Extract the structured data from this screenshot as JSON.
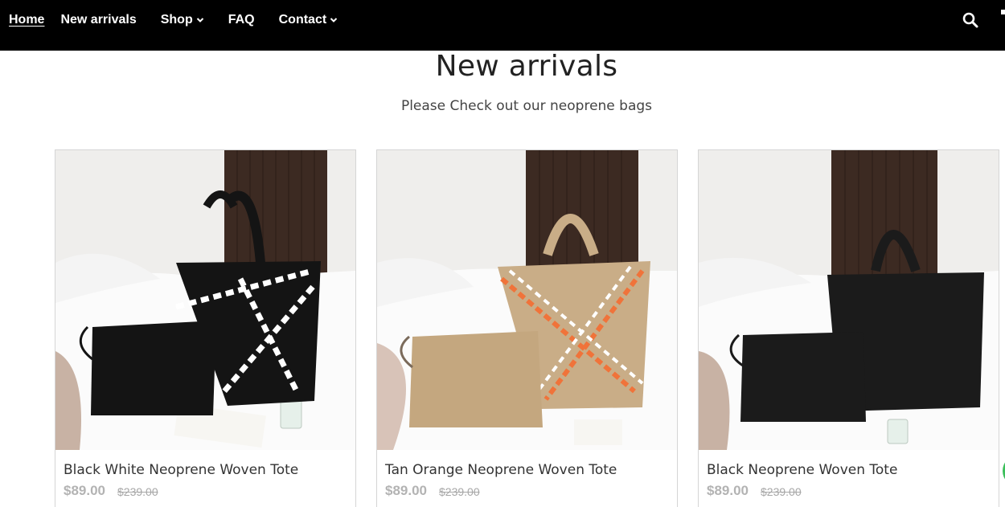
{
  "nav": {
    "items": [
      {
        "label": "Home",
        "dropdown": false,
        "active": true
      },
      {
        "label": "New arrivals",
        "dropdown": false,
        "active": false
      },
      {
        "label": "Shop",
        "dropdown": true,
        "active": false
      },
      {
        "label": "FAQ",
        "dropdown": false,
        "active": false
      },
      {
        "label": "Contact",
        "dropdown": true,
        "active": false
      }
    ],
    "search_icon": "search-icon"
  },
  "section": {
    "title": "New arrivals",
    "subtitle": "Please Check out our neoprene bags"
  },
  "products": [
    {
      "title": "Black White Neoprene Woven Tote",
      "price": "$89.00",
      "old_price": "$239.00",
      "bag_color": "#141414",
      "accent_colors": [
        "#ffffff"
      ]
    },
    {
      "title": "Tan Orange Neoprene Woven Tote",
      "price": "$89.00",
      "old_price": "$239.00",
      "bag_color": "#c9ad87",
      "accent_colors": [
        "#f0733a",
        "#ffffff"
      ]
    },
    {
      "title": "Black Neoprene Woven Tote",
      "price": "$89.00",
      "old_price": "$239.00",
      "bag_color": "#1b1b1b",
      "accent_colors": []
    }
  ],
  "colors": {
    "header_bg": "#000000",
    "price_text": "#b3b3b3",
    "chat_bubble": "#3bbf5a"
  }
}
